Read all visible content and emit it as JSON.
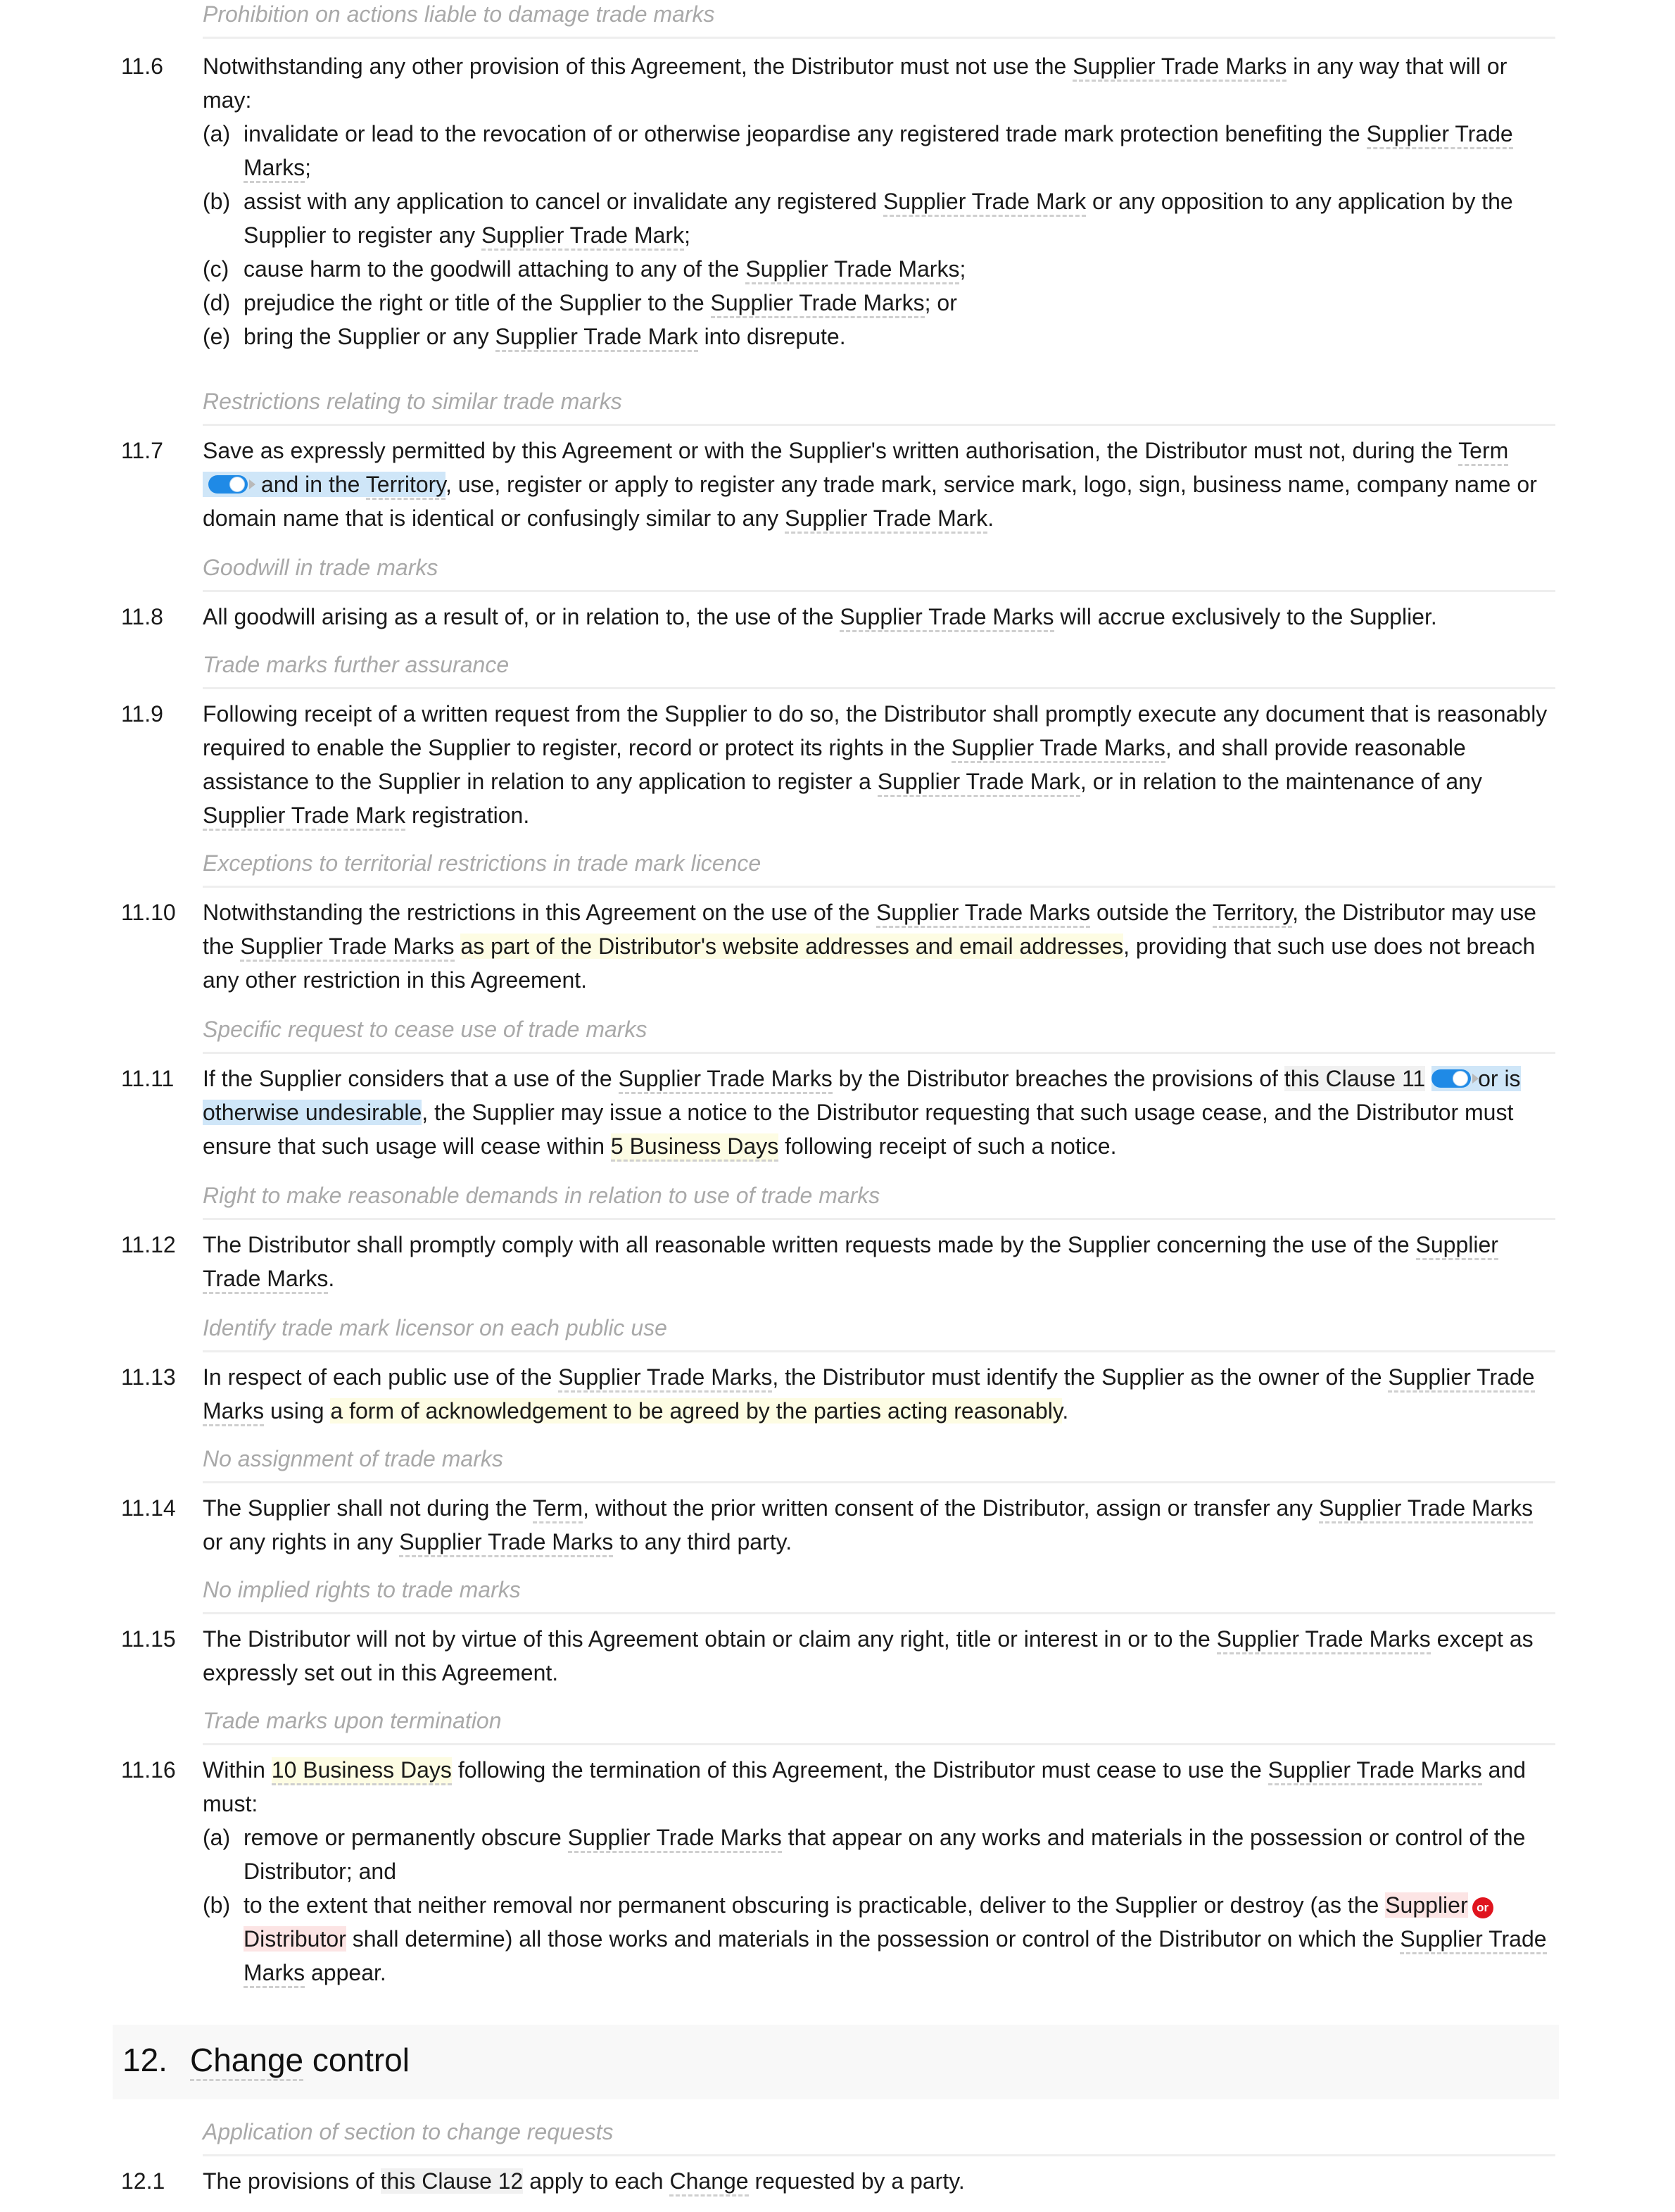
{
  "clauses": {
    "c11_6": {
      "subhead": "Prohibition on actions liable to damage trade marks",
      "num": "11.6",
      "intro": [
        "Notwithstanding any other provision of this Agreement, the Distributor must not use the ",
        "Supplier Trade Marks",
        " in any way that will or may:"
      ],
      "items": [
        {
          "label": "(a)",
          "parts": [
            "invalidate or lead to the revocation of or otherwise jeopardise any registered trade mark protection benefiting the ",
            "Supplier Trade Marks",
            ";"
          ]
        },
        {
          "label": "(b)",
          "parts": [
            "assist with any application to cancel or invalidate any registered ",
            "Supplier Trade Mark",
            " or any opposition to any application by the Supplier to register any ",
            "Supplier Trade Mark",
            ";"
          ]
        },
        {
          "label": "(c)",
          "parts": [
            "cause harm to the goodwill attaching to any of the ",
            "Supplier Trade Marks",
            ";"
          ]
        },
        {
          "label": "(d)",
          "parts": [
            "prejudice the right or title of the Supplier to the ",
            "Supplier Trade Marks",
            "; or"
          ]
        },
        {
          "label": "(e)",
          "parts": [
            "bring the Supplier or any ",
            "Supplier Trade Mark",
            " into disrepute."
          ]
        }
      ]
    },
    "c11_7": {
      "subhead": "Restrictions relating to similar trade marks",
      "num": "11.7",
      "parts": [
        "Save as expressly permitted by this Agreement or with the Supplier's written authorisation, the Distributor must not, during the ",
        "Term",
        " and in the ",
        "Territory",
        ", use, register or apply to register any trade mark, service mark, logo, sign, business name, company name or domain name that is identical or confusingly similar to any ",
        "Supplier Trade Mark",
        "."
      ],
      "toggle_on": true
    },
    "c11_8": {
      "subhead": "Goodwill in trade marks",
      "num": "11.8",
      "parts": [
        "All goodwill arising as a result of, or in relation to, the use of the ",
        "Supplier Trade Marks",
        " will accrue exclusively to the Supplier."
      ]
    },
    "c11_9": {
      "subhead": "Trade marks further assurance",
      "num": "11.9",
      "parts": [
        "Following receipt of a written request from the Supplier to do so, the Distributor shall promptly execute any document that is reasonably required to enable the Supplier to register, record or protect its rights in the ",
        "Supplier Trade Marks",
        ", and shall provide reasonable assistance to the Supplier in relation to any application to register a ",
        "Supplier Trade Mark",
        ", or in relation to the maintenance of any ",
        "Supplier Trade Mark",
        " registration."
      ]
    },
    "c11_10": {
      "subhead": "Exceptions to territorial restrictions in trade mark licence",
      "num": "11.10",
      "parts": [
        "Notwithstanding the restrictions in this Agreement on the use of the ",
        "Supplier Trade Marks",
        " outside the ",
        "Territory",
        ", the Distributor may use the ",
        "Supplier Trade Marks",
        " ",
        "as part of the Distributor's website addresses and email addresses",
        ", providing that such use does not breach any other restriction in this Agreement."
      ]
    },
    "c11_11": {
      "subhead": "Specific request to cease use of trade marks",
      "num": "11.11",
      "parts": [
        "If the Supplier considers that a use of the ",
        "Supplier Trade Marks",
        " by the Distributor breaches the provisions of ",
        "this Clause 11",
        " ",
        "or is otherwise undesirable",
        ", the Supplier may issue a notice to the Distributor requesting that such usage cease, and the Distributor must ensure that such usage will cease within ",
        "5 Business Days",
        " following receipt of such a notice."
      ],
      "toggle_on": true
    },
    "c11_12": {
      "subhead": "Right to make reasonable demands in relation to use of trade marks",
      "num": "11.12",
      "parts": [
        "The Distributor shall promptly comply with all reasonable written requests made by the Supplier concerning the use of the ",
        "Supplier Trade Marks",
        "."
      ]
    },
    "c11_13": {
      "subhead": "Identify trade mark licensor on each public use",
      "num": "11.13",
      "parts": [
        "In respect of each public use of the ",
        "Supplier Trade Marks",
        ", the Distributor must identify the Supplier as the owner of the ",
        "Supplier Trade Marks",
        " using ",
        "a form of acknowledgement to be agreed by the parties acting reasonably",
        "."
      ]
    },
    "c11_14": {
      "subhead": "No assignment of trade marks",
      "num": "11.14",
      "parts": [
        "The Supplier shall not during the ",
        "Term",
        ", without the prior written consent of the Distributor, assign or transfer any ",
        "Supplier Trade Marks",
        " or any rights in any ",
        "Supplier Trade Marks",
        " to any third party."
      ]
    },
    "c11_15": {
      "subhead": "No implied rights to trade marks",
      "num": "11.15",
      "parts": [
        "The Distributor will not by virtue of this Agreement obtain or claim any right, title or interest in or to the ",
        "Supplier Trade Marks",
        " except as expressly set out in this Agreement."
      ]
    },
    "c11_16": {
      "subhead": "Trade marks upon termination",
      "num": "11.16",
      "intro": [
        "Within ",
        "10 Business Days",
        " following the termination of this Agreement, the Distributor must cease to use the ",
        "Supplier Trade Marks",
        " and must:"
      ],
      "items": [
        {
          "label": "(a)",
          "parts": [
            "remove or permanently obscure ",
            "Supplier Trade Marks",
            " that appear on any works and materials in the possession or control of the Distributor; and"
          ]
        },
        {
          "label": "(b)",
          "parts": [
            "to the extent that neither removal nor permanent obscuring is practicable, deliver to the Supplier or destroy (as the ",
            "Supplier",
            "or",
            "Distributor",
            " shall determine) all those works and materials in the possession or control of the Distributor on which the ",
            "Supplier Trade Marks",
            " appear."
          ]
        }
      ]
    }
  },
  "section12": {
    "number": "12.",
    "title": "Change control",
    "subhead": "Application of section to change requests",
    "c12_1": {
      "num": "12.1",
      "parts": [
        "The provisions of ",
        "this Clause 12",
        " apply to each ",
        "Change",
        " requested by a party."
      ]
    }
  },
  "colors": {
    "defined_term_underline": "#cfcfcf",
    "highlight_yellow": "#fdfce3",
    "highlight_blue": "#cfe6f8",
    "highlight_red": "#fce4e4",
    "toggle_blue": "#1f8ae6",
    "or_badge_red": "#e0141e",
    "subhead_gray": "#a9a9a9"
  }
}
